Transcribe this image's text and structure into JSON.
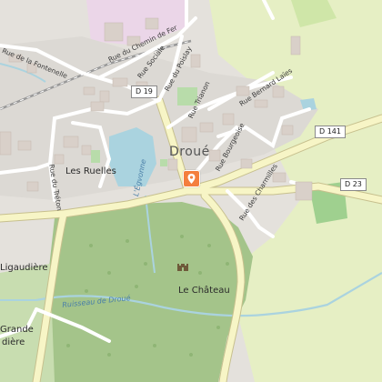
{
  "map": {
    "place_labels": {
      "town": "Droué",
      "ruelles": "Les Ruelles",
      "chateau": "Le Château",
      "ligaudiere": "Ligaudière",
      "grande_line1": "Grande",
      "grande_line2": "dière"
    },
    "street_labels": {
      "fontenelle": "Rue de la Fontenelle",
      "chemin_de_fer": "Rue du Chemin de Fer",
      "sociale": "Rue Sociale",
      "poislay": "Rue du Poislay",
      "trianon": "Rue Trianon",
      "bernard_laies": "Rue Bernard Laïes",
      "bourgeoise": "Rue Bourgeoise",
      "charmilles": "Rue des Charmilles",
      "treton": "Rue du Tréton"
    },
    "water_labels": {
      "egvonne": "L'Égvonne",
      "ruisseau": "Ruisseau de Droué"
    },
    "road_shields": {
      "d19": "D 19",
      "d141": "D 141",
      "d23": "D 23"
    },
    "icons": {
      "poi_marker": "location-pin-icon",
      "castle": "castle-icon"
    },
    "colors": {
      "background": "#f2efe9",
      "forest": "#a4c48a",
      "meadow": "#e6efc4",
      "water": "#aad3df",
      "major_road": "#f7f5c6",
      "minor_road": "#ffffff",
      "building": "#d9d0c9",
      "marker": "#f47f3e"
    }
  }
}
